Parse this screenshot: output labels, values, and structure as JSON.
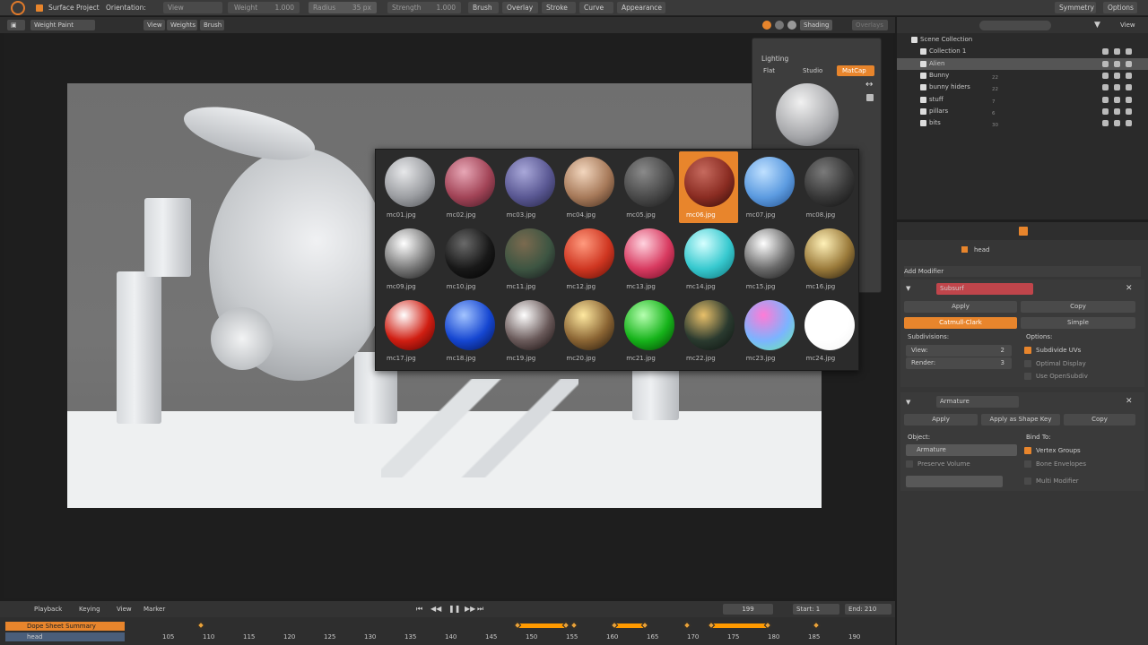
{
  "topbar": {
    "surface_project": "Surface Project",
    "orientation_label": "Orientation:",
    "orientation_value": "View",
    "weight_label": "Weight",
    "weight_value": "1.000",
    "radius_label": "Radius",
    "radius_value": "35 px",
    "strength_label": "Strength",
    "strength_value": "1.000",
    "menus": [
      "Brush",
      "Overlay",
      "Stroke",
      "Curve",
      "Appearance"
    ],
    "symmetry": "Symmetry",
    "options": "Options"
  },
  "viewport_header": {
    "mode": "Weight Paint",
    "menus": [
      "View",
      "Weights",
      "Brush"
    ],
    "shading": "Shading",
    "overlays": "Overlays"
  },
  "shading_popover": {
    "lighting": "Lighting",
    "tabs": [
      "Flat",
      "Studio",
      "MatCap"
    ],
    "active_tab": "MatCap"
  },
  "matcaps": [
    {
      "name": "mc01.jpg",
      "colors": [
        "#e7e8ea",
        "#9c9ea2",
        "#4b4d51"
      ]
    },
    {
      "name": "mc02.jpg",
      "colors": [
        "#e7a7b6",
        "#a24457",
        "#3d1520"
      ]
    },
    {
      "name": "mc03.jpg",
      "colors": [
        "#a9a8d9",
        "#5a5893",
        "#20203f"
      ]
    },
    {
      "name": "mc04.jpg",
      "colors": [
        "#f2d6be",
        "#a77a5a",
        "#3c2719"
      ]
    },
    {
      "name": "mc05.jpg",
      "colors": [
        "#8a8a8a",
        "#4a4a4a",
        "#161616"
      ]
    },
    {
      "name": "mc06.jpg",
      "colors": [
        "#c66a5e",
        "#8a2c22",
        "#2e0c08"
      ]
    },
    {
      "name": "mc07.jpg",
      "colors": [
        "#bfe0ff",
        "#5c9be0",
        "#1f4b87"
      ]
    },
    {
      "name": "mc08.jpg",
      "colors": [
        "#7a7a7a",
        "#383838",
        "#0d0d0d"
      ]
    },
    {
      "name": "mc09.jpg",
      "colors": [
        "#ffffff",
        "#777777",
        "#111111"
      ]
    },
    {
      "name": "mc10.jpg",
      "colors": [
        "#6a6a6a",
        "#181818",
        "#000000"
      ]
    },
    {
      "name": "mc11.jpg",
      "colors": [
        "#7b6a4f",
        "#3d5542",
        "#15151a"
      ]
    },
    {
      "name": "mc12.jpg",
      "colors": [
        "#ff9a7e",
        "#cf3621",
        "#5a0d04"
      ]
    },
    {
      "name": "mc13.jpg",
      "colors": [
        "#ffd3df",
        "#d83a60",
        "#6a0a22"
      ]
    },
    {
      "name": "mc14.jpg",
      "colors": [
        "#d6ffff",
        "#37c9cf",
        "#0b6e74"
      ]
    },
    {
      "name": "mc15.jpg",
      "colors": [
        "#ffffff",
        "#6a6a6a",
        "#121212"
      ]
    },
    {
      "name": "mc16.jpg",
      "colors": [
        "#fff1b8",
        "#9a7a3a",
        "#1d150a"
      ]
    },
    {
      "name": "mc17.jpg",
      "colors": [
        "#ffffff",
        "#d01e12",
        "#4a0000"
      ]
    },
    {
      "name": "mc18.jpg",
      "colors": [
        "#a3c4ff",
        "#1546d1",
        "#021046"
      ]
    },
    {
      "name": "mc19.jpg",
      "colors": [
        "#ffffff",
        "#6a5a5a",
        "#100808"
      ]
    },
    {
      "name": "mc20.jpg",
      "colors": [
        "#ffe9a0",
        "#8a6433",
        "#1d1309"
      ]
    },
    {
      "name": "mc21.jpg",
      "colors": [
        "#b6ffb0",
        "#16b31a",
        "#003a00"
      ]
    },
    {
      "name": "mc22.jpg",
      "colors": [
        "#e8c06a",
        "#2a3a2f",
        "#0b100d"
      ]
    },
    {
      "name": "mc23.jpg",
      "colors": [
        "#ff7bd6",
        "#7bb4ff",
        "#6bf0a0"
      ]
    },
    {
      "name": "mc24.jpg",
      "colors": [
        "#ffffff",
        "#ffffff",
        "#f2f2f2"
      ]
    }
  ],
  "selected_matcap": "mc06.jpg",
  "outliner": {
    "view": "View",
    "items": [
      {
        "label": "Scene Collection",
        "indent": 0
      },
      {
        "label": "Collection 1",
        "indent": 1
      },
      {
        "label": "Alien",
        "indent": 1,
        "selected": true
      },
      {
        "label": "Bunny",
        "indent": 1,
        "badge": "22"
      },
      {
        "label": "bunny hiders",
        "indent": 1,
        "badge": "22"
      },
      {
        "label": "stuff",
        "indent": 1,
        "badge": "7"
      },
      {
        "label": "pillars",
        "indent": 1,
        "badge": "6"
      },
      {
        "label": "bits",
        "indent": 1,
        "badge": "30"
      }
    ]
  },
  "properties": {
    "object_name": "head",
    "add_modifier": "Add Modifier",
    "subsurf": {
      "name": "Subsurf",
      "apply": "Apply",
      "copy": "Copy",
      "catmull": "Catmull-Clark",
      "simple": "Simple",
      "subdivisions": "Subdivisions:",
      "view_label": "View:",
      "view_value": "2",
      "render_label": "Render:",
      "render_value": "3",
      "options": "Options:",
      "subdivide_uvs": "Subdivide UVs",
      "optimal_display": "Optimal Display",
      "use_opensubdiv": "Use OpenSubdiv"
    },
    "armature": {
      "name": "Armature",
      "apply": "Apply",
      "apply_shape": "Apply as Shape Key",
      "copy": "Copy",
      "object_label": "Object:",
      "object_value": "Armature",
      "bind_to": "Bind To:",
      "vertex_groups": "Vertex Groups",
      "bone_envelopes": "Bone Envelopes",
      "preserve_volume": "Preserve Volume",
      "multi_modifier": "Multi Modifier"
    }
  },
  "timeline": {
    "menus": [
      "Playback",
      "Keying",
      "View",
      "Marker"
    ],
    "current_frame": "199",
    "start_label": "Start:",
    "start_value": "1",
    "end_label": "End:",
    "end_value": "210",
    "summary": "Dope Sheet Summary",
    "head": "head",
    "ticks": [
      "105",
      "110",
      "115",
      "120",
      "125",
      "130",
      "135",
      "140",
      "145",
      "150",
      "155",
      "160",
      "165",
      "170",
      "175",
      "180",
      "185",
      "190"
    ]
  },
  "colors": {
    "accent": "#e8852c"
  }
}
